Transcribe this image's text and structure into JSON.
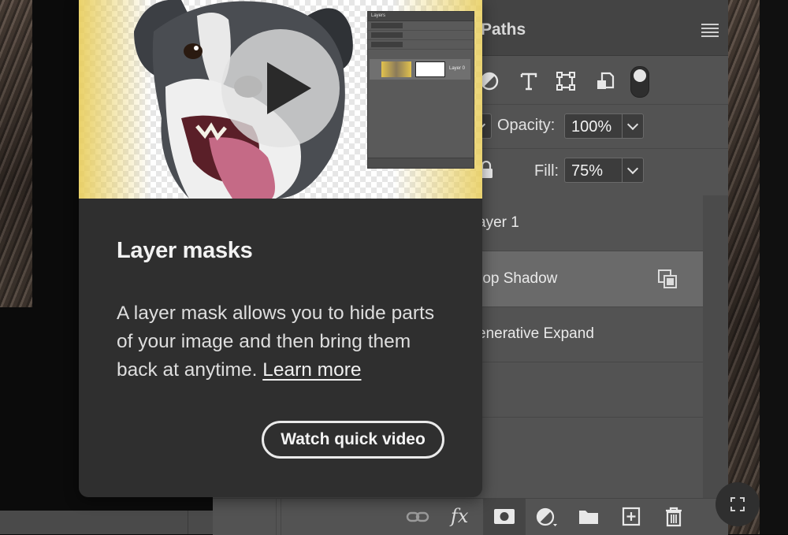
{
  "panel": {
    "tab_paths": "Paths",
    "filter_icons": [
      "adjustment-filter-icon",
      "type-filter-icon",
      "shape-filter-icon",
      "smart-object-filter-icon"
    ],
    "opacity": {
      "label": "Opacity:",
      "value": "100%"
    },
    "fill": {
      "label": "Fill:",
      "value": "75%"
    },
    "layers": [
      {
        "label": "ayer 1",
        "active": false
      },
      {
        "label": "rop Shadow",
        "active": true,
        "badge": "linked-layers-icon"
      },
      {
        "label": "enerative Expand",
        "active": false
      },
      {
        "label": "",
        "active": false
      }
    ],
    "bottom_icons": [
      "link-layers-icon",
      "fx-icon",
      "add-mask-icon",
      "adjustment-layer-icon",
      "group-folder-icon",
      "new-layer-icon",
      "trash-icon"
    ],
    "fx_text": "fx"
  },
  "card": {
    "title": "Layer masks",
    "body": "A layer mask allows you to hide parts of your image and then bring them back at anytime.",
    "learn_more": "Learn more",
    "watch_button": "Watch quick video",
    "mini_panel": {
      "title": "Layers",
      "layer_label": "Layer 0"
    }
  }
}
